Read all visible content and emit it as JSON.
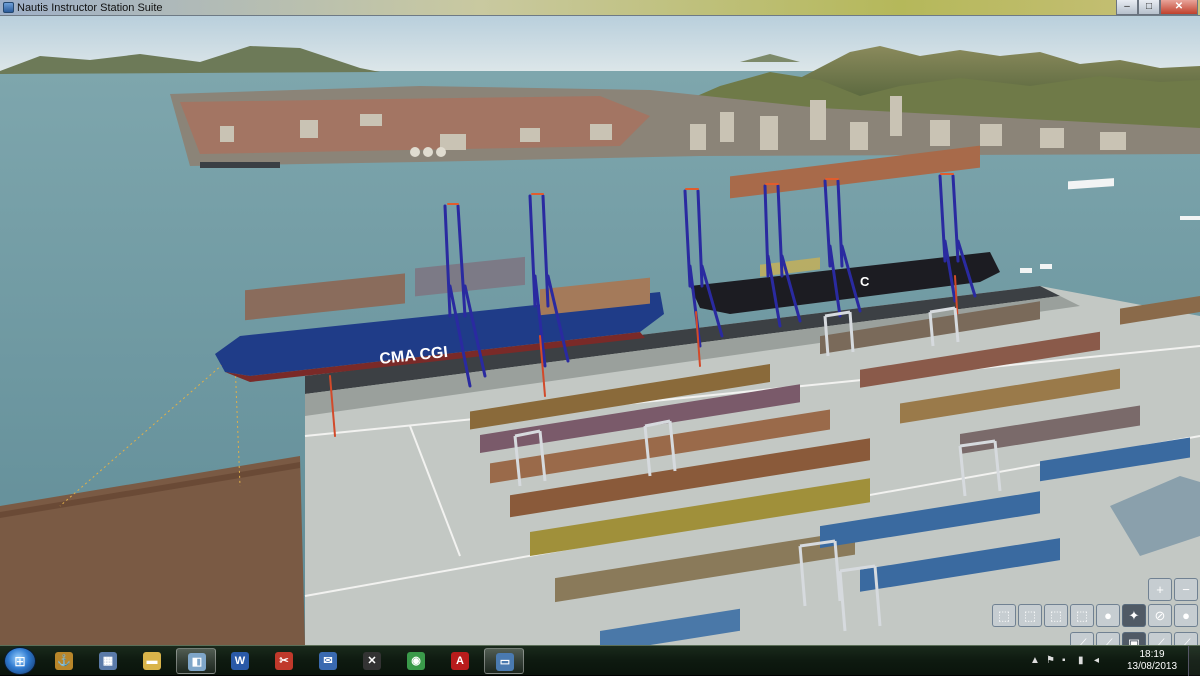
{
  "window": {
    "title": "Nautis Instructor Station Suite"
  },
  "window_controls": {
    "minimize": "–",
    "maximize": "□",
    "close": "✕"
  },
  "ship_labels": {
    "near_ship": "CMA CGI",
    "far_ship": "C"
  },
  "taskbar": {
    "start": "⊞",
    "items": [
      {
        "name": "nautis-icon",
        "glyph": "⚓",
        "color": "#b8862a"
      },
      {
        "name": "calculator-icon",
        "glyph": "▦",
        "color": "#5a7aa8"
      },
      {
        "name": "folder-icon",
        "glyph": "▬",
        "color": "#d9b44a"
      },
      {
        "name": "sim-window-icon",
        "glyph": "◧",
        "color": "#7fa6c9"
      },
      {
        "name": "word-icon",
        "glyph": "W",
        "color": "#2a5aa8"
      },
      {
        "name": "snipping-icon",
        "glyph": "✂",
        "color": "#c0392b"
      },
      {
        "name": "thunderbird-icon",
        "glyph": "✉",
        "color": "#3a6ab0"
      },
      {
        "name": "xmind-icon",
        "glyph": "✕",
        "color": "#333333"
      },
      {
        "name": "chrome-icon",
        "glyph": "◉",
        "color": "#3a9a4a"
      },
      {
        "name": "acrobat-icon",
        "glyph": "A",
        "color": "#b81c1c"
      },
      {
        "name": "remote-icon",
        "glyph": "▭",
        "color": "#4a7ab0"
      }
    ],
    "clock_time": "18:19",
    "clock_date": "13/08/2013"
  },
  "colors": {
    "sea": "#6f9aa3",
    "sky": "#c9dbe4",
    "quay": "#c8cdc9",
    "land": "#7a5a44"
  }
}
